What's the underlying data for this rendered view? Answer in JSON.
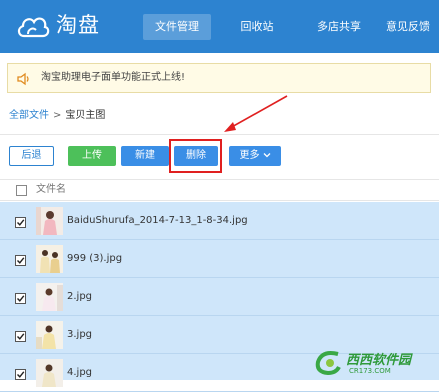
{
  "app": {
    "brand": "淘盘"
  },
  "nav": [
    {
      "label": "文件管理",
      "active": true
    },
    {
      "label": "回收站",
      "active": false
    },
    {
      "label": "多店共享",
      "active": false
    },
    {
      "label": "意见反馈",
      "active": false
    }
  ],
  "notice": {
    "text": "淘宝助理电子面单功能正式上线!"
  },
  "breadcrumb": {
    "root": "全部文件",
    "separator": ">",
    "current": "宝贝主图"
  },
  "toolbar": {
    "back": "后退",
    "upload": "上传",
    "new_folder": "新建",
    "delete": "删除",
    "more": "更多"
  },
  "list": {
    "column_name": "文件名",
    "files": [
      {
        "name": "BaiduShurufa_2014-7-13_1-8-34.jpg",
        "checked": true
      },
      {
        "name": "999 (3).jpg",
        "checked": true
      },
      {
        "name": "2.jpg",
        "checked": true
      },
      {
        "name": "3.jpg",
        "checked": true
      },
      {
        "name": "4.jpg",
        "checked": true
      }
    ]
  },
  "watermark": {
    "name": "西西软件园",
    "site": "CR173.COM"
  },
  "colors": {
    "header": "#2d83d0",
    "upload_green": "#4dc05a",
    "button_blue": "#3a8ee6",
    "annotation_red": "#e02020",
    "selected_row": "#cfe6fa"
  },
  "annotation": {
    "highlighted": "delete-button"
  }
}
